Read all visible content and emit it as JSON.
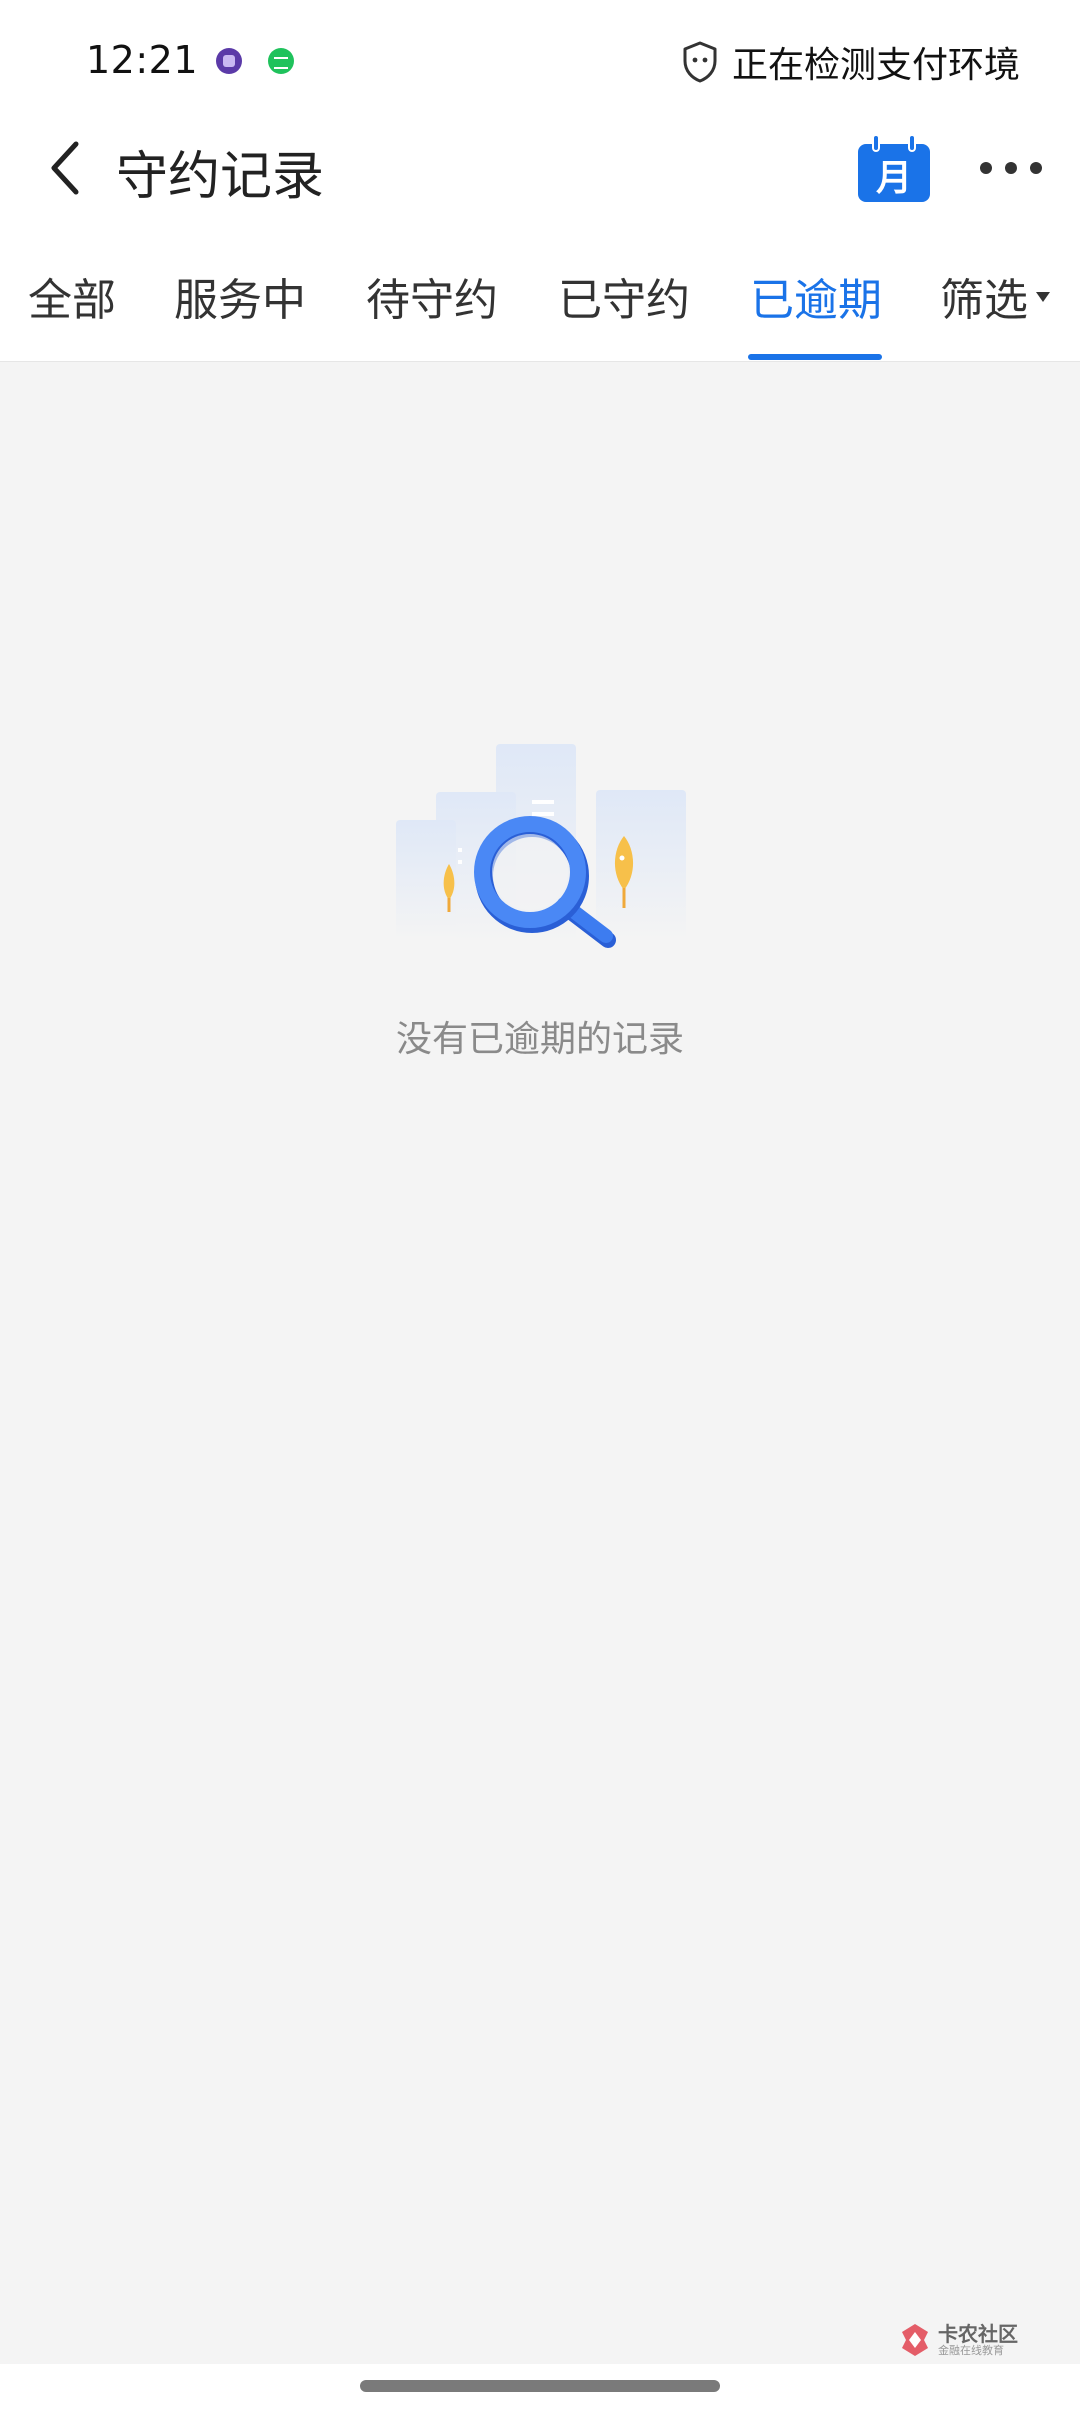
{
  "status_bar": {
    "time": "12:21",
    "pay_status_text": "正在检测支付环境"
  },
  "header": {
    "title": "守约记录",
    "calendar_label": "月"
  },
  "tabs": [
    {
      "label": "全部",
      "active": false
    },
    {
      "label": "服务中",
      "active": false
    },
    {
      "label": "待守约",
      "active": false
    },
    {
      "label": "已守约",
      "active": false
    },
    {
      "label": "已逾期",
      "active": true
    },
    {
      "label": "筛选",
      "active": false
    }
  ],
  "empty_state": {
    "message": "没有已逾期的记录",
    "icon": "search-magnifier-illustration"
  },
  "watermark": {
    "title": "卡农社区",
    "subtitle": "金融在线教育"
  },
  "colors": {
    "accent": "#1a73e8",
    "background": "#f4f4f4",
    "muted_text": "#8a8a8a"
  }
}
